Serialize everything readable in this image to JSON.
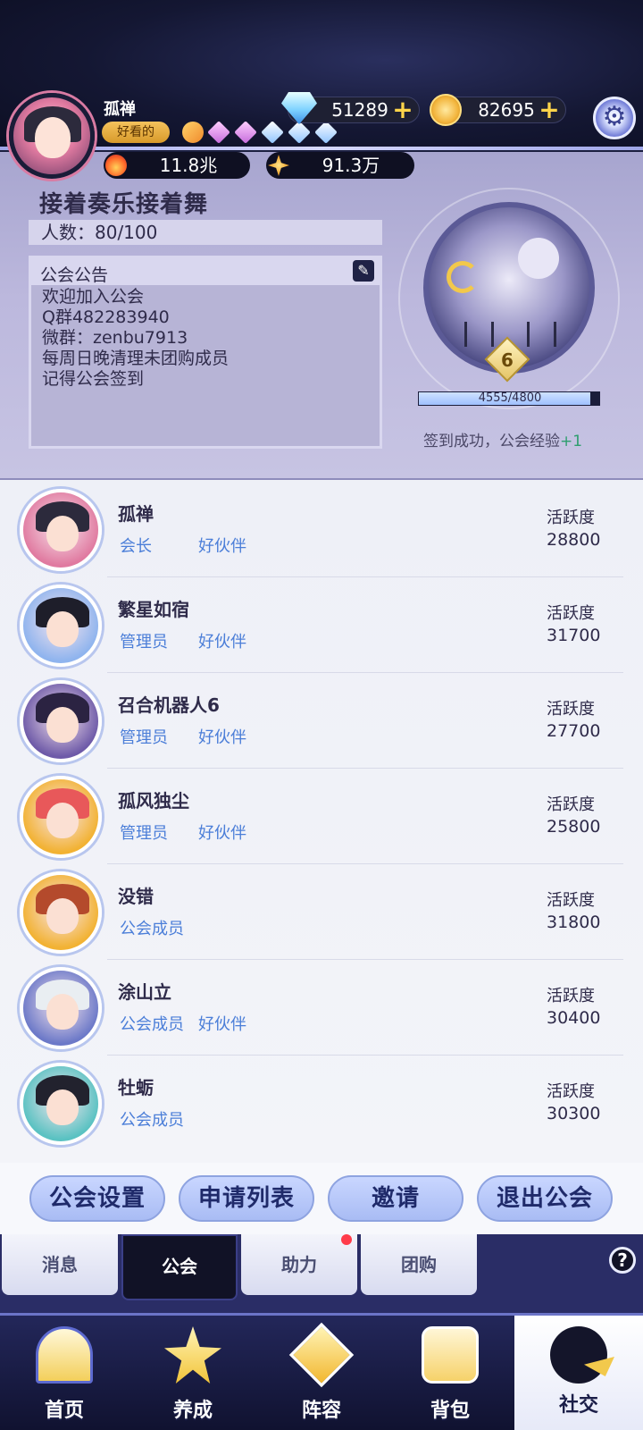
{
  "player": {
    "name": "孤禅",
    "tag": "好看的",
    "power": "11.8兆",
    "fame": "91.3万",
    "gem_icons": [
      "orange-badge-icon",
      "pink-diamond-icon",
      "pink-diamond-icon",
      "blue-diamond-icon",
      "blue-diamond-icon",
      "blue-diamond-icon"
    ]
  },
  "currency": {
    "diamonds": "51289",
    "coins": "82695",
    "plus_symbol": "+"
  },
  "guild": {
    "name": "接着奏乐接着舞",
    "members_label": "人数：80/100",
    "notice_title": "公会公告",
    "notice_lines": [
      "欢迎加入公会",
      "Q群482283940",
      "微群：zenbu7913",
      "每周日晚清理未团购成员",
      "记得公会签到"
    ],
    "level": "6",
    "xp_text": "4555/4800",
    "xp_current": 4555,
    "xp_max": 4800,
    "signin_text": "签到成功，公会经验",
    "signin_plus": "+1"
  },
  "members": [
    {
      "name": "孤禅",
      "role": "会长",
      "relation": "好伙伴",
      "activity_label": "活跃度",
      "activity": "28800",
      "avatar_color": "#2c2a3c",
      "ring_color": "#e07aa0"
    },
    {
      "name": "繁星如宿",
      "role": "管理员",
      "relation": "好伙伴",
      "activity_label": "活跃度",
      "activity": "31700",
      "avatar_color": "#1e1e2a",
      "ring_color": "#8fb4ee"
    },
    {
      "name": "召合机器人6",
      "role": "管理员",
      "relation": "好伙伴",
      "activity_label": "活跃度",
      "activity": "27700",
      "avatar_color": "#2b2342",
      "ring_color": "#6e5aa8"
    },
    {
      "name": "孤风独尘",
      "role": "管理员",
      "relation": "好伙伴",
      "activity_label": "活跃度",
      "activity": "25800",
      "avatar_color": "#e8585a",
      "ring_color": "#f2b233"
    },
    {
      "name": "没错",
      "role": "公会成员",
      "relation": "",
      "activity_label": "活跃度",
      "activity": "31800",
      "avatar_color": "#b44a2c",
      "ring_color": "#f2b233"
    },
    {
      "name": "涂山立",
      "role": "公会成员",
      "relation": "好伙伴",
      "activity_label": "活跃度",
      "activity": "30400",
      "avatar_color": "#e9eef2",
      "ring_color": "#6c79c8"
    },
    {
      "name": "牡蛎",
      "role": "公会成员",
      "relation": "",
      "activity_label": "活跃度",
      "activity": "30300",
      "avatar_color": "#22222e",
      "ring_color": "#5ac2c2"
    }
  ],
  "actions": {
    "settings": "公会设置",
    "applications": "申请列表",
    "invite": "邀请",
    "leave": "退出公会"
  },
  "subtabs": {
    "messages": "消息",
    "guild": "公会",
    "assist": "助力",
    "group_buy": "团购",
    "help": "?"
  },
  "nav": {
    "home": "首页",
    "grow": "养成",
    "team": "阵容",
    "bag": "背包",
    "social": "社交"
  },
  "colors": {
    "accent_blue": "#4b7ed8",
    "panel": "#bcb8dd",
    "dark": "#141733",
    "gold": "#f2c84b",
    "signin_green": "#2e9e6e",
    "badge_red": "#ff3b4a"
  }
}
